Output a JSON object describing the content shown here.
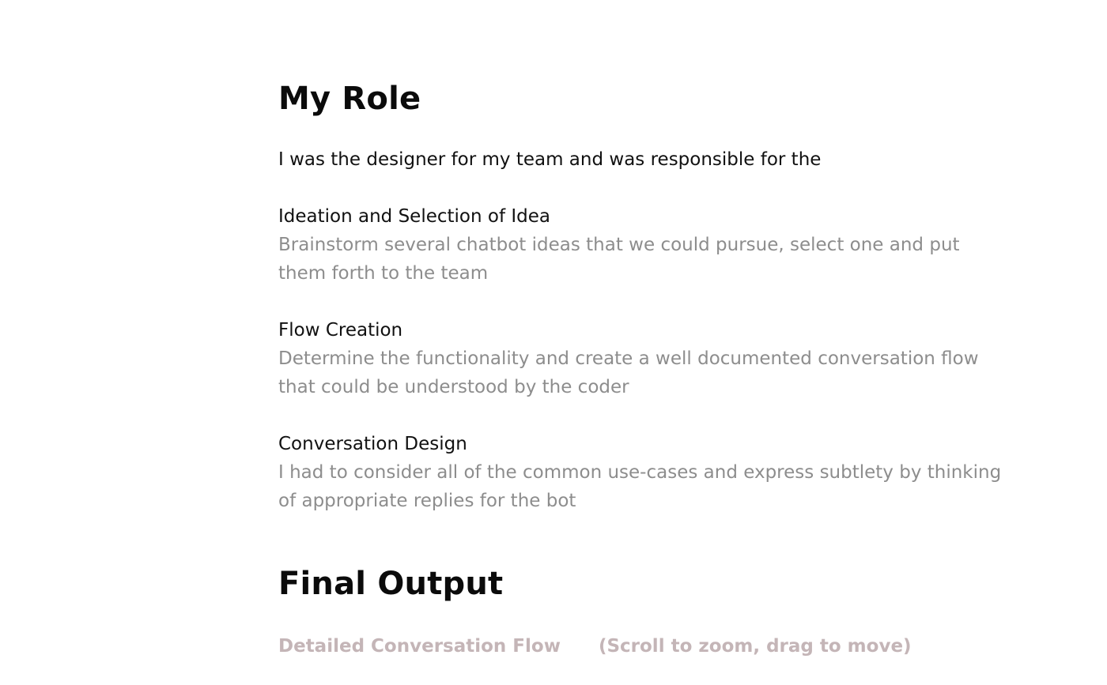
{
  "my_role": {
    "title": "My Role",
    "intro": "I was the designer for my team and was responsible for the",
    "items": [
      {
        "heading": "Ideation and Selection of Idea",
        "description": "Brainstorm several chatbot ideas that we could pursue, select one and put them forth to the team"
      },
      {
        "heading": "Flow Creation",
        "description": "Determine the functionality and create a well documented conversation flow that could be understood by the coder"
      },
      {
        "heading": "Conversation Design",
        "description": "I had to consider all of the common use-cases and express subtlety by thinking of appropriate replies for the bot"
      }
    ]
  },
  "final_output": {
    "title": "Final Output",
    "flow_label": "Detailed Conversation Flow",
    "hint": "(Scroll to zoom, drag to move)"
  },
  "colors": {
    "heading": "#0b0b0b",
    "body_text": "#111111",
    "muted_text": "#8d8d8d",
    "caption_text": "#c4b5b7",
    "background": "#ffffff"
  }
}
